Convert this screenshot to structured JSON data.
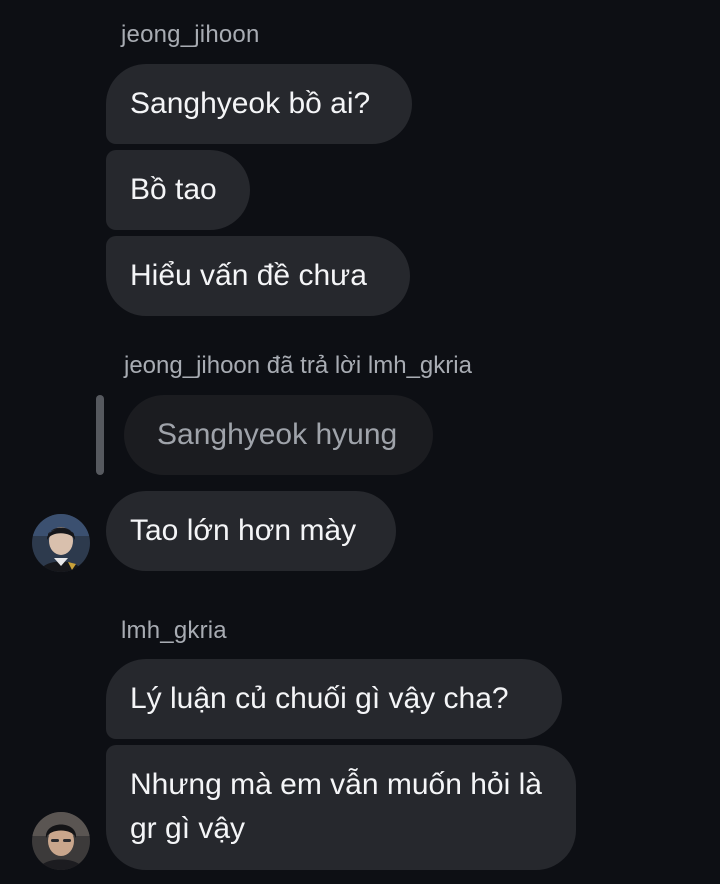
{
  "thread": {
    "group1": {
      "sender": "jeong_jihoon",
      "messages": [
        "Sanghyeok bồ ai?",
        "Bồ tao",
        "Hiểu vấn đề chưa"
      ]
    },
    "reply": {
      "label": "jeong_jihoon đã trả lời lmh_gkria",
      "quoted": "Sanghyeok hyung",
      "message": "Tao lớn hơn mày"
    },
    "group2": {
      "sender": "lmh_gkria",
      "messages": [
        "Lý luận củ chuối gì vậy cha?",
        "Nhưng mà em vẫn muốn hỏi là gr gì vậy"
      ]
    }
  },
  "avatars": {
    "jeong_jihoon": "user-avatar",
    "lmh_gkria": "user-avatar"
  },
  "colors": {
    "background": "#0d0f14",
    "bubble": "#26282d",
    "quoted_bubble": "#1b1c20",
    "secondary_text": "#a8acb3"
  }
}
